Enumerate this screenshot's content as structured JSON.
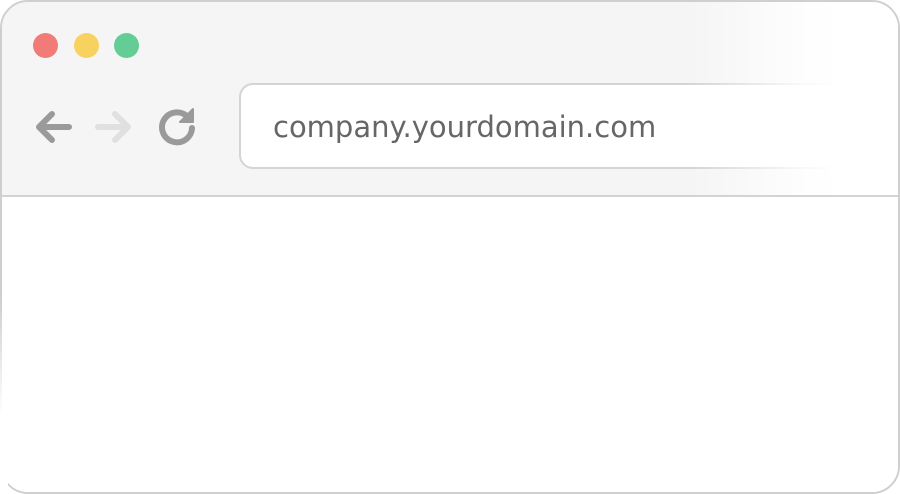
{
  "window": {
    "traffic_lights": {
      "close_color": "#f27b78",
      "minimize_color": "#f7d25e",
      "maximize_color": "#64cd95"
    }
  },
  "toolbar": {
    "back_icon": "arrow-left-icon",
    "forward_icon": "arrow-right-icon",
    "reload_icon": "reload-icon",
    "address": {
      "url": "company.yourdomain.com"
    }
  }
}
